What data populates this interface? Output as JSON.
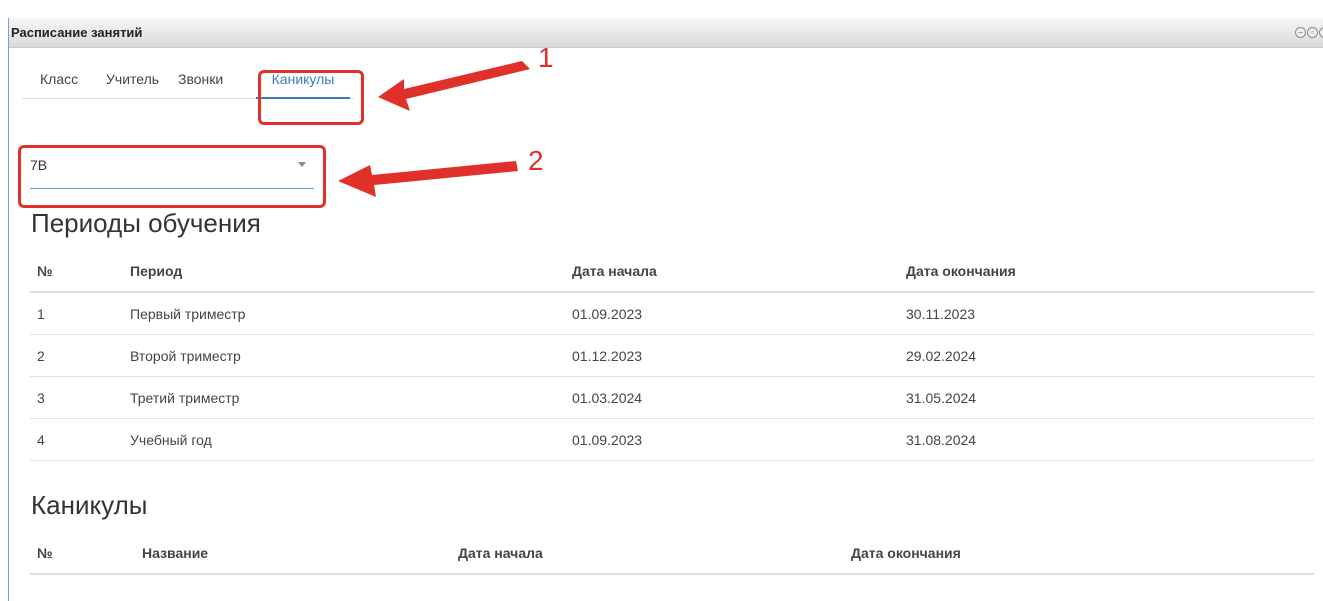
{
  "window": {
    "title": "Расписание занятий",
    "controls": [
      "minimize-icon",
      "maximize-icon",
      "close-icon"
    ]
  },
  "tabs": [
    {
      "label": "Класс",
      "active": false
    },
    {
      "label": "Учитель",
      "active": false
    },
    {
      "label": "Звонки",
      "active": false
    },
    {
      "label": "Каникулы",
      "active": true
    }
  ],
  "class_select": {
    "value": "7В"
  },
  "annotations": [
    {
      "number": "1"
    },
    {
      "number": "2"
    }
  ],
  "periods": {
    "heading": "Периоды обучения",
    "columns": [
      "№",
      "Период",
      "Дата начала",
      "Дата окончания"
    ],
    "rows": [
      [
        "1",
        "Первый триместр",
        "01.09.2023",
        "30.11.2023"
      ],
      [
        "2",
        "Второй триместр",
        "01.12.2023",
        "29.02.2024"
      ],
      [
        "3",
        "Третий триместр",
        "01.03.2024",
        "31.05.2024"
      ],
      [
        "4",
        "Учебный год",
        "01.09.2023",
        "31.08.2024"
      ]
    ]
  },
  "holidays": {
    "heading": "Каникулы",
    "columns": [
      "№",
      "Название",
      "Дата начала",
      "Дата окончания"
    ],
    "rows": []
  },
  "colors": {
    "accent": "#3c7bc0",
    "annotation": "#e0302a"
  }
}
